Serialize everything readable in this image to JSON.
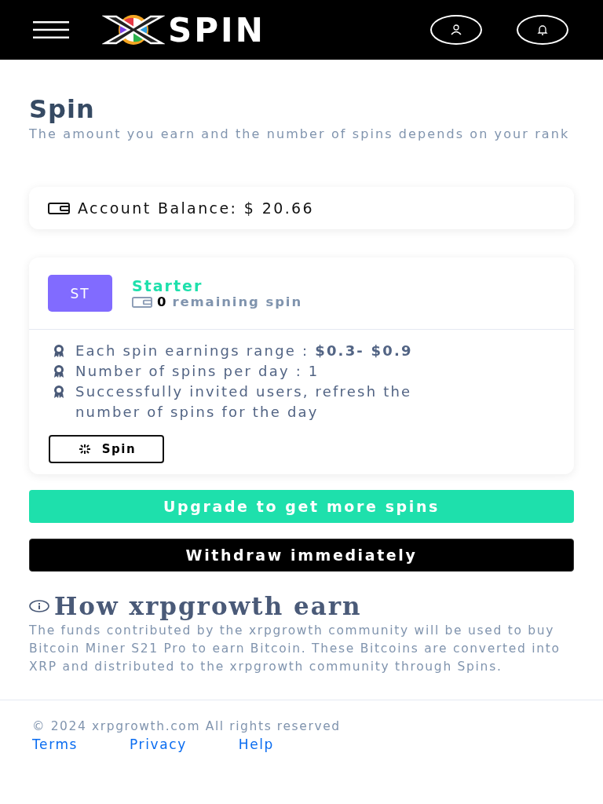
{
  "header": {
    "logo_text": "SPIN"
  },
  "page": {
    "title": "Spin",
    "subtitle": "The amount you earn and the number of spins depends on your rank"
  },
  "balance": {
    "label": "Account Balance: $ 20.66"
  },
  "rank": {
    "badge": "ST",
    "name": "Starter",
    "remaining_count": "0",
    "remaining_label": "remaining spin",
    "features": [
      "Each spin earnings range : **$0.3- $0.9**",
      "Number of spins per day : 1",
      "Successfully invited users, refresh the number of spins for the day"
    ],
    "spin_button": "Spin"
  },
  "buttons": [
    {
      "label": "Upgrade to get more spins",
      "kind": "primary"
    },
    {
      "label": "Withdraw immediately",
      "kind": "dark"
    }
  ],
  "info": {
    "title": "How xrpgrowth earn",
    "text": "The funds contributed by the xrpgrowth community will be used to buy Bitcoin Miner S21 Pro to earn Bitcoin. These Bitcoins are converted into XRP and distributed to the xrpgrowth community through Spins."
  },
  "footer": {
    "copyright": "© 2024 xrpgrowth.com All rights reserved",
    "links": [
      "Terms",
      "Privacy",
      "Help"
    ]
  }
}
